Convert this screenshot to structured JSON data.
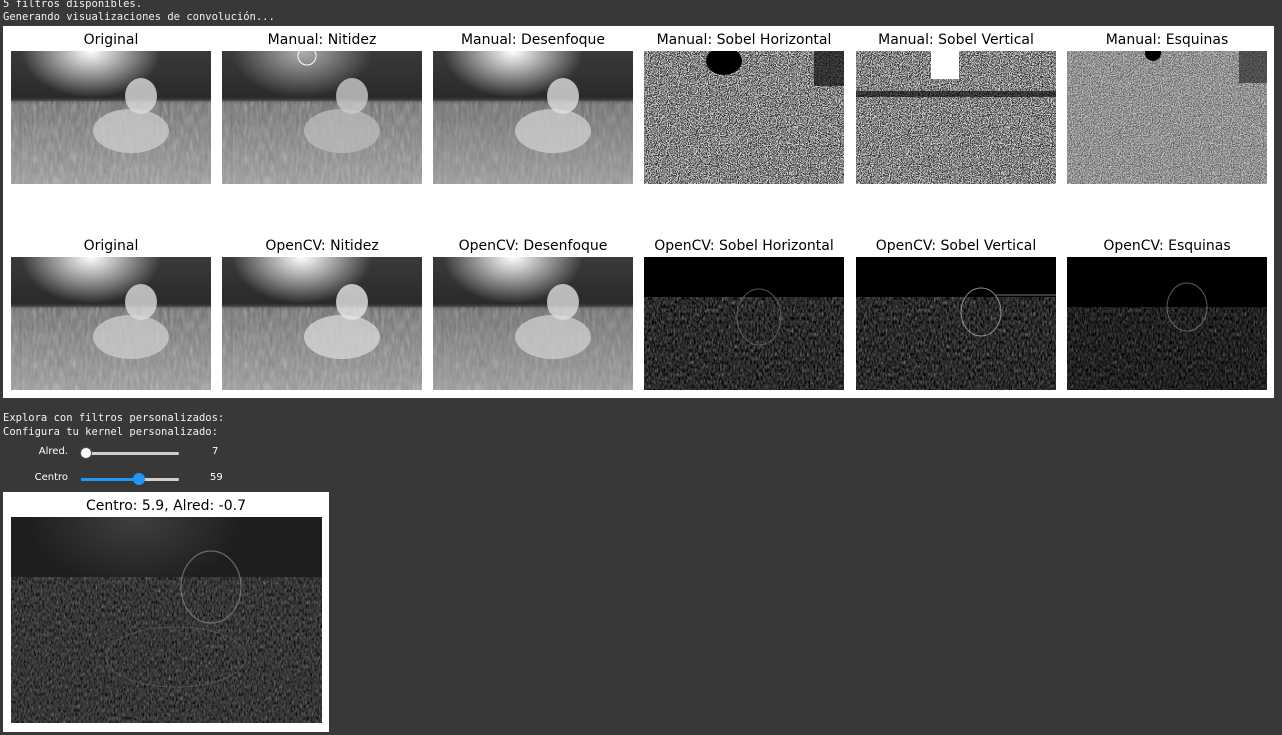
{
  "log": {
    "line1": "5 filtros disponibles.",
    "line2": "Generando visualizaciones de convolución...",
    "line3": "Explora con filtros personalizados:",
    "line4": "Configura tu kernel personalizado:"
  },
  "grid": {
    "row1": [
      "Original",
      "Manual: Nitidez",
      "Manual: Desenfoque",
      "Manual: Sobel Horizontal",
      "Manual: Sobel Vertical",
      "Manual: Esquinas"
    ],
    "row2": [
      "Original",
      "OpenCV: Nitidez",
      "OpenCV: Desenfoque",
      "OpenCV: Sobel Horizontal",
      "OpenCV: Sobel Vertical",
      "OpenCV: Esquinas"
    ]
  },
  "sliders": {
    "alred": {
      "label": "Alred.",
      "value": "7",
      "level": 0.05,
      "color": "#ffffff"
    },
    "centro": {
      "label": "Centro",
      "value": "59",
      "level": 0.59,
      "color": "#2196f3"
    }
  },
  "custom": {
    "title": "Centro: 5.9, Alred: -0.7"
  }
}
